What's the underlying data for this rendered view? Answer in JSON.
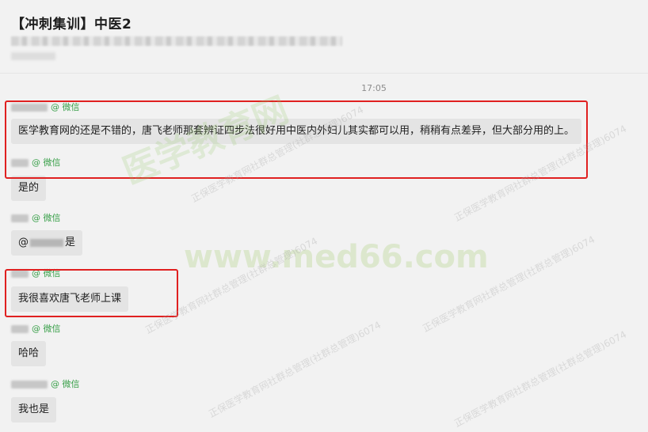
{
  "header": {
    "title": "【冲刺集训】中医2"
  },
  "time_divider": "17:05",
  "messages": [
    {
      "source": "@ 微信",
      "text": "医学教育网的还是不错的，唐飞老师那套辨证四步法很好用中医内外妇儿其实都可以用，稍稍有点差异，但大部分用的上。"
    },
    {
      "source": "@ 微信",
      "text": "是的"
    },
    {
      "source": "@ 微信",
      "text_prefix": "@",
      "text_suffix": "是"
    },
    {
      "source": "@ 微信",
      "text": "我很喜欢唐飞老师上课"
    },
    {
      "source": "@ 微信",
      "text": "哈哈"
    },
    {
      "source": "@ 微信",
      "text": "我也是"
    }
  ],
  "watermark": {
    "cn": "医学教育网",
    "url": "www.med66.com",
    "small": "正保医学教育网社群总管理(社群总管理)6074"
  },
  "colors": {
    "background": "#f2f2f2",
    "bubble": "#e4e4e4",
    "source_green": "#3aa04a",
    "highlight_red": "#e02020"
  }
}
